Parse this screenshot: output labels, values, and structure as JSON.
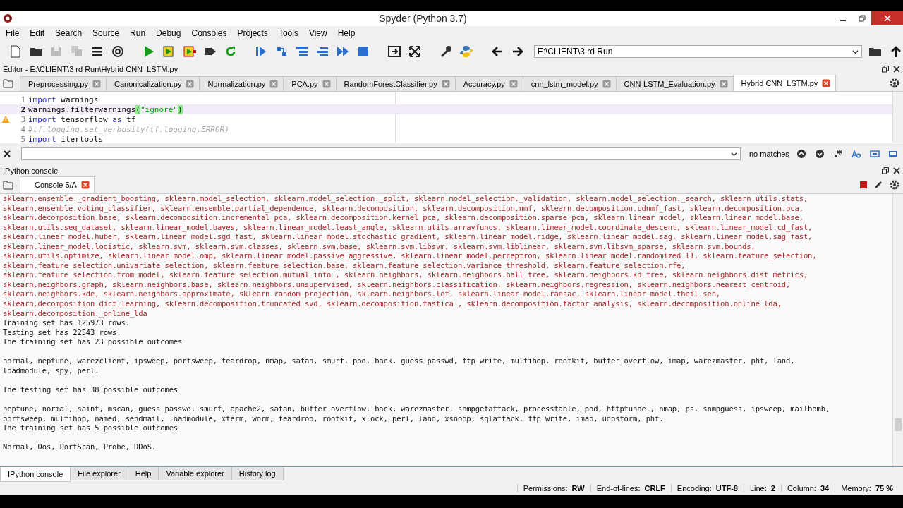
{
  "window": {
    "title": "Spyder (Python 3.7)"
  },
  "menu": [
    "File",
    "Edit",
    "Search",
    "Source",
    "Run",
    "Debug",
    "Consoles",
    "Projects",
    "Tools",
    "View",
    "Help"
  ],
  "toolbar": {
    "path": "E:\\CLIENT\\3 rd Run"
  },
  "editor": {
    "title": "Editor - E:\\CLIENT\\3 rd Run\\Hybrid CNN_LSTM.py",
    "tabs": [
      {
        "label": "Preprocessing.py",
        "selected": false
      },
      {
        "label": "Canonicalization.py",
        "selected": false
      },
      {
        "label": "Normalization.py",
        "selected": false
      },
      {
        "label": "PCA.py",
        "selected": false
      },
      {
        "label": "RandomForestClassifier.py",
        "selected": false
      },
      {
        "label": "Accuracy.py",
        "selected": false
      },
      {
        "label": "cnn_lstm_model.py",
        "selected": false
      },
      {
        "label": "CNN-LSTM_Evaluation.py",
        "selected": false
      },
      {
        "label": "Hybrid CNN_LSTM.py",
        "selected": true
      }
    ],
    "lines": [
      {
        "number": "1",
        "current": false,
        "warning": false,
        "tokens": [
          {
            "kind": "keyword",
            "text": "import"
          },
          {
            "kind": "name",
            "text": " warnings"
          }
        ]
      },
      {
        "number": "2",
        "current": true,
        "warning": false,
        "tokens": [
          {
            "kind": "name",
            "text": "warnings.filterwarnings"
          },
          {
            "kind": "paren",
            "text": "("
          },
          {
            "kind": "string",
            "text": "\"ignore\""
          },
          {
            "kind": "paren",
            "text": ")"
          }
        ]
      },
      {
        "number": "3",
        "current": false,
        "warning": true,
        "tokens": [
          {
            "kind": "keyword",
            "text": "import"
          },
          {
            "kind": "name",
            "text": " tensorflow "
          },
          {
            "kind": "keyword",
            "text": "as"
          },
          {
            "kind": "name",
            "text": " tf"
          }
        ]
      },
      {
        "number": "4",
        "current": false,
        "warning": false,
        "tokens": [
          {
            "kind": "comment",
            "text": "#tf.logging.set_verbosity(tf.logging.ERROR)"
          }
        ]
      },
      {
        "number": "5",
        "current": false,
        "warning": false,
        "tokens": [
          {
            "kind": "keyword",
            "text": "import"
          },
          {
            "kind": "name",
            "text": " itertools"
          }
        ]
      }
    ]
  },
  "find": {
    "status": "no matches"
  },
  "console": {
    "title": "IPython console",
    "tabs": [
      {
        "label": "Console 5/A",
        "selected": true
      }
    ],
    "lines": [
      {
        "kind": "error",
        "text": "sklearn.ensemble._gradient_boosting, sklearn.model_selection, sklearn.model_selection._split, sklearn.model_selection._validation, sklearn.model_selection._search, sklearn.utils.stats,"
      },
      {
        "kind": "error",
        "text": "sklearn.ensemble.voting_classifier, sklearn.ensemble.partial_dependence, sklearn.decomposition, sklearn.decomposition.nmf, sklearn.decomposition.cdnmf_fast, sklearn.decomposition.pca,"
      },
      {
        "kind": "error",
        "text": "sklearn.decomposition.base, sklearn.decomposition.incremental_pca, sklearn.decomposition.kernel_pca, sklearn.decomposition.sparse_pca, sklearn.linear_model, sklearn.linear_model.base,"
      },
      {
        "kind": "error",
        "text": "sklearn.utils.seq_dataset, sklearn.linear_model.bayes, sklearn.linear_model.least_angle, sklearn.utils.arrayfuncs, sklearn.linear_model.coordinate_descent, sklearn.linear_model.cd_fast,"
      },
      {
        "kind": "error",
        "text": "sklearn.linear_model.huber, sklearn.linear_model.sgd_fast, sklearn.linear_model.stochastic_gradient, sklearn.linear_model.ridge, sklearn.linear_model.sag, sklearn.linear_model.sag_fast,"
      },
      {
        "kind": "error",
        "text": "sklearn.linear_model.logistic, sklearn.svm, sklearn.svm.classes, sklearn.svm.base, sklearn.svm.libsvm, sklearn.svm.liblinear, sklearn.svm.libsvm_sparse, sklearn.svm.bounds,"
      },
      {
        "kind": "error",
        "text": "sklearn.utils.optimize, sklearn.linear_model.omp, sklearn.linear_model.passive_aggressive, sklearn.linear_model.perceptron, sklearn.linear_model.randomized_l1, sklearn.feature_selection,"
      },
      {
        "kind": "error",
        "text": "sklearn.feature_selection.univariate_selection, sklearn.feature_selection.base, sklearn.feature_selection.variance_threshold, sklearn.feature_selection.rfe,"
      },
      {
        "kind": "error",
        "text": "sklearn.feature_selection.from_model, sklearn.feature_selection.mutual_info_, sklearn.neighbors, sklearn.neighbors.ball_tree, sklearn.neighbors.kd_tree, sklearn.neighbors.dist_metrics,"
      },
      {
        "kind": "error",
        "text": "sklearn.neighbors.graph, sklearn.neighbors.base, sklearn.neighbors.unsupervised, sklearn.neighbors.classification, sklearn.neighbors.regression, sklearn.neighbors.nearest_centroid,"
      },
      {
        "kind": "error",
        "text": "sklearn.neighbors.kde, sklearn.neighbors.approximate, sklearn.random_projection, sklearn.neighbors.lof, sklearn.linear_model.ransac, sklearn.linear_model.theil_sen,"
      },
      {
        "kind": "error",
        "text": "sklearn.decomposition.dict_learning, sklearn.decomposition.truncated_svd, sklearn.decomposition.fastica_, sklearn.decomposition.factor_analysis, sklearn.decomposition.online_lda,"
      },
      {
        "kind": "error",
        "text": "sklearn.decomposition._online_lda"
      },
      {
        "kind": "output",
        "text": "Training set has 125973 rows."
      },
      {
        "kind": "output",
        "text": "Testing set has 22543 rows."
      },
      {
        "kind": "output",
        "text": "The training set has 23 possible outcomes"
      },
      {
        "kind": "blank"
      },
      {
        "kind": "output",
        "text": "normal, neptune, warezclient, ipsweep, portsweep, teardrop, nmap, satan, smurf, pod, back, guess_passwd, ftp_write, multihop, rootkit, buffer_overflow, imap, warezmaster, phf, land,"
      },
      {
        "kind": "output",
        "text": "loadmodule, spy, perl."
      },
      {
        "kind": "blank"
      },
      {
        "kind": "output",
        "text": "The testing set has 38 possible outcomes"
      },
      {
        "kind": "blank"
      },
      {
        "kind": "output",
        "text": "neptune, normal, saint, mscan, guess_passwd, smurf, apache2, satan, buffer_overflow, back, warezmaster, snmpgetattack, processtable, pod, httptunnel, nmap, ps, snmpguess, ipsweep, mailbomb,"
      },
      {
        "kind": "output",
        "text": "portsweep, multihop, named, sendmail, loadmodule, xterm, worm, teardrop, rootkit, xlock, perl, land, xsnoop, sqlattack, ftp_write, imap, udpstorm, phf."
      },
      {
        "kind": "output",
        "text": "The training set has 5 possible outcomes"
      },
      {
        "kind": "blank"
      },
      {
        "kind": "output",
        "text": "Normal, Dos, PortScan, Probe, DDoS."
      }
    ]
  },
  "dock_tabs": [
    {
      "label": "IPython console",
      "selected": true
    },
    {
      "label": "File explorer",
      "selected": false
    },
    {
      "label": "Help",
      "selected": false
    },
    {
      "label": "Variable explorer",
      "selected": false
    },
    {
      "label": "History log",
      "selected": false
    }
  ],
  "status_bar": [
    {
      "label": "Permissions:",
      "value": "RW"
    },
    {
      "label": "End-of-lines:",
      "value": "CRLF"
    },
    {
      "label": "Encoding:",
      "value": "UTF-8"
    },
    {
      "label": "Line:",
      "value": "2"
    },
    {
      "label": "Column:",
      "value": "34"
    },
    {
      "label": "Memory:",
      "value": "75 %"
    }
  ]
}
